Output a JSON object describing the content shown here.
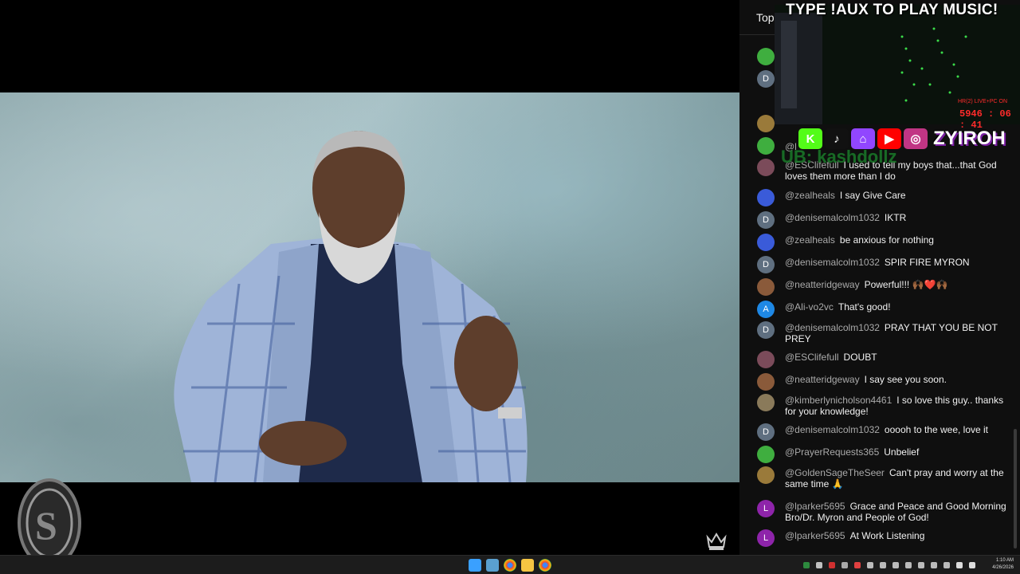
{
  "chat": {
    "header_label": "Top",
    "messages": [
      {
        "author": "@ESClifefull",
        "text": "I used to tell my boys that...that God loves them more than I do",
        "avatar_color": "#7b4b5a",
        "initial": ""
      },
      {
        "author": "@zealheals",
        "text": "I say Give Care",
        "avatar_color": "#3a5bd9",
        "initial": ""
      },
      {
        "author": "@denisemalcolm1032",
        "text": "IKTR",
        "avatar_color": "#5f6f80",
        "initial": "D"
      },
      {
        "author": "@zealheals",
        "text": "be anxious for nothing",
        "avatar_color": "#3a5bd9",
        "initial": ""
      },
      {
        "author": "@denisemalcolm1032",
        "text": "SPIR FIRE MYRON",
        "avatar_color": "#5f6f80",
        "initial": "D"
      },
      {
        "author": "@neatteridgeway",
        "text": "Powerful!!! 🙌🏾❤️🙌🏾",
        "avatar_color": "#8a5a3a",
        "initial": ""
      },
      {
        "author": "@Ali-vo2vc",
        "text": "That's good!",
        "avatar_color": "#1e88e5",
        "initial": "A"
      },
      {
        "author": "@denisemalcolm1032",
        "text": "PRAY THAT YOU BE NOT PREY",
        "avatar_color": "#5f6f80",
        "initial": "D"
      },
      {
        "author": "@ESClifefull",
        "text": "DOUBT",
        "avatar_color": "#7b4b5a",
        "initial": ""
      },
      {
        "author": "@neatteridgeway",
        "text": "I say see you soon.",
        "avatar_color": "#8a5a3a",
        "initial": ""
      },
      {
        "author": "@kimberlynicholson4461",
        "text": "I so love this guy.. thanks for your knowledge!",
        "avatar_color": "#8a7a5a",
        "initial": ""
      },
      {
        "author": "@denisemalcolm1032",
        "text": "ooooh to the wee, love it",
        "avatar_color": "#5f6f80",
        "initial": "D"
      },
      {
        "author": "@PrayerRequests365",
        "text": "Unbelief",
        "avatar_color": "#3fae3f",
        "initial": ""
      },
      {
        "author": "@GoldenSageTheSeer",
        "text": "Can't pray and worry at the same time 🙏",
        "avatar_color": "#9a7a3a",
        "initial": ""
      },
      {
        "author": "@lparker5695",
        "text": "Grace and Peace and Good Morning Bro/Dr. Myron and People of God!",
        "avatar_color": "#8e24aa",
        "initial": "L"
      },
      {
        "author": "@lparker5695",
        "text": "At Work Listening",
        "avatar_color": "#8e24aa",
        "initial": "L"
      }
    ],
    "top_avatars": [
      {
        "avatar_color": "#3fae3f",
        "initial": ""
      },
      {
        "avatar_color": "#5f6f80",
        "initial": "D"
      },
      {
        "avatar_color": "#9a7a3a",
        "initial": ""
      },
      {
        "avatar_color": "#3fae3f",
        "initial": ""
      }
    ],
    "partial_author": "@l"
  },
  "overlay": {
    "banner": "TYPE !AUX TO PLAY MUSIC!",
    "timer_label": "HR(2) LIVE+PC ON",
    "timer": "5946 : 06 : 41",
    "handle": "ZYIROH",
    "sub_handle": "UB: kashdollz",
    "social_icons": [
      "kick-icon",
      "tiktok-icon",
      "twitch-icon",
      "youtube-icon",
      "instagram-icon"
    ],
    "social_glyphs": [
      "K",
      "♪",
      "⌂",
      "▶",
      "◎"
    ],
    "social_colors": [
      "#53fc18",
      "#111111",
      "#9146ff",
      "#ff0000",
      "#c13584"
    ]
  },
  "taskbar": {
    "clock_time": "1:10 AM",
    "clock_date": "4/26/2026"
  },
  "colors": {
    "chat_bg": "#0f0f0f",
    "author": "#aaaaaa",
    "timer": "#ff2b2b"
  }
}
